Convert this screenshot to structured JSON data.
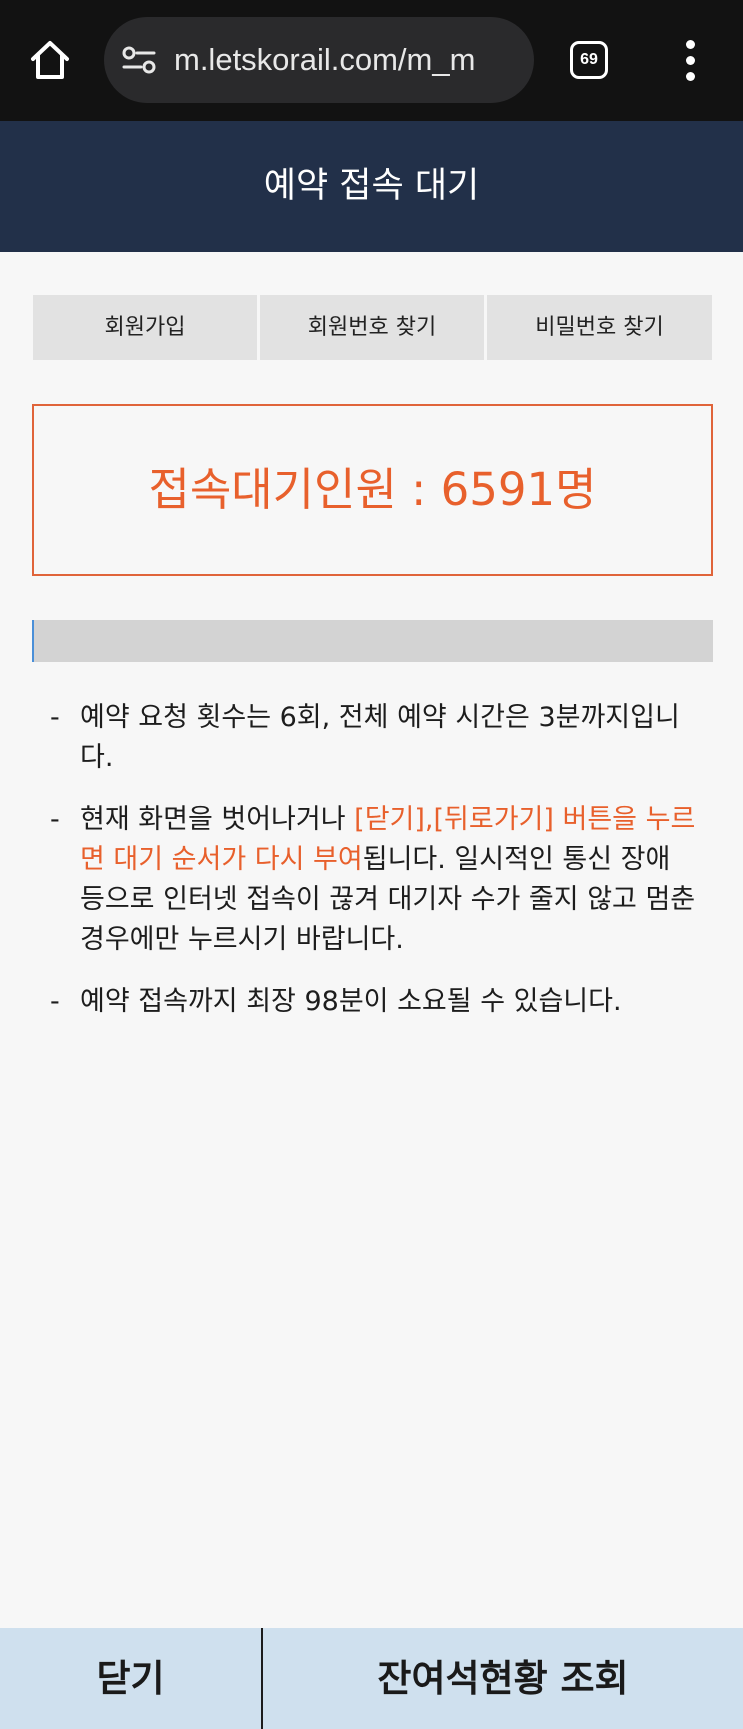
{
  "browser": {
    "url": "m.letskorail.com/m_m",
    "tab_count": "69"
  },
  "header": {
    "title": "예약 접속 대기"
  },
  "member_buttons": [
    {
      "label": "회원가입"
    },
    {
      "label": "회원번호 찾기"
    },
    {
      "label": "비밀번호 찾기"
    }
  ],
  "queue": {
    "text": "접속대기인원 : 6591명"
  },
  "progress": {
    "value": 0
  },
  "notices": {
    "dash": "-",
    "n1": "예약 요청 횟수는 6회, 전체 예약 시간은 3분까지입니다.",
    "n2_prefix": "현재 화면을 벗어나거나 ",
    "n2_highlight": "[닫기],[뒤로가기] 버튼을 누르면 대기 순서가 다시 부여",
    "n2_suffix": "됩니다. 일시적인 통신 장애 등으로 인터넷 접속이 끊겨 대기자 수가 줄지 않고 멈춘 경우에만 누르시기 바랍니다.",
    "n3": "예약 접속까지 최장 98분이 소요될 수 있습니다."
  },
  "bottom": {
    "close_label": "닫기",
    "seats_label": "잔여석현황 조회"
  },
  "colors": {
    "header_bg": "#223049",
    "accent_orange": "#e8602c",
    "bottom_bg": "#cfe0ee"
  }
}
